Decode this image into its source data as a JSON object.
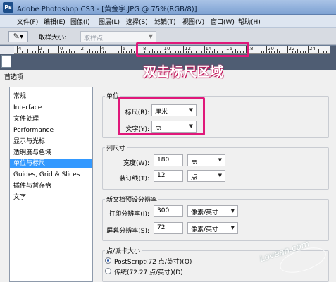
{
  "window": {
    "app_badge": "Ps",
    "title": "Adobe Photoshop CS3 - [黄金字.JPG @ 75%(RGB/8)]"
  },
  "menu": [
    "文件(F)",
    "编辑(E)",
    "图像(I)",
    "图层(L)",
    "选择(S)",
    "滤镜(T)",
    "视图(V)",
    "窗口(W)",
    "帮助(H)"
  ],
  "options_bar": {
    "tool_icon": "eyedropper-icon",
    "sample_size_label": "取样大小:",
    "sample_size_value": "取样点"
  },
  "ruler": {
    "labels": [
      "4",
      "2",
      "0",
      "2",
      "4",
      "6",
      "8",
      "10",
      "12",
      "14",
      "16",
      "18",
      "20",
      "22",
      "24"
    ]
  },
  "annotation": "双击标尺区域",
  "dialog": {
    "title": "首选项",
    "categories": [
      "常规",
      "Interface",
      "文件处理",
      "Performance",
      "显示与光标",
      "透明度与色域",
      "单位与标尺",
      "Guides, Grid & Slices",
      "插件与暂存盘",
      "文字"
    ],
    "selected_category": "单位与标尺",
    "units": {
      "title": "单位",
      "ruler_label": "标尺(R):",
      "ruler_value": "厘米",
      "type_label": "文字(Y):",
      "type_value": "点"
    },
    "column_size": {
      "title": "列尺寸",
      "width_label": "宽度(W):",
      "width_value": "180",
      "width_unit": "点",
      "gutter_label": "装订线(T):",
      "gutter_value": "12",
      "gutter_unit": "点"
    },
    "new_doc": {
      "title": "新文档预设分辨率",
      "print_label": "打印分辨率(I):",
      "print_value": "300",
      "print_unit": "像素/英寸",
      "screen_label": "屏幕分辨率(S):",
      "screen_value": "72",
      "screen_unit": "像素/英寸"
    },
    "point_size": {
      "title": "点/派卡大小",
      "postscript_label": "PostScript(72 点/英寸)(O)",
      "traditional_label": "传统(72.27 点/英寸)(D)",
      "selected": "PostScript(72 点/英寸)(O)"
    }
  },
  "watermark": "Lovean.com",
  "colors": {
    "highlight": "#e0187a",
    "selection": "#3399ff",
    "titlebar": "#7ea2d3"
  }
}
